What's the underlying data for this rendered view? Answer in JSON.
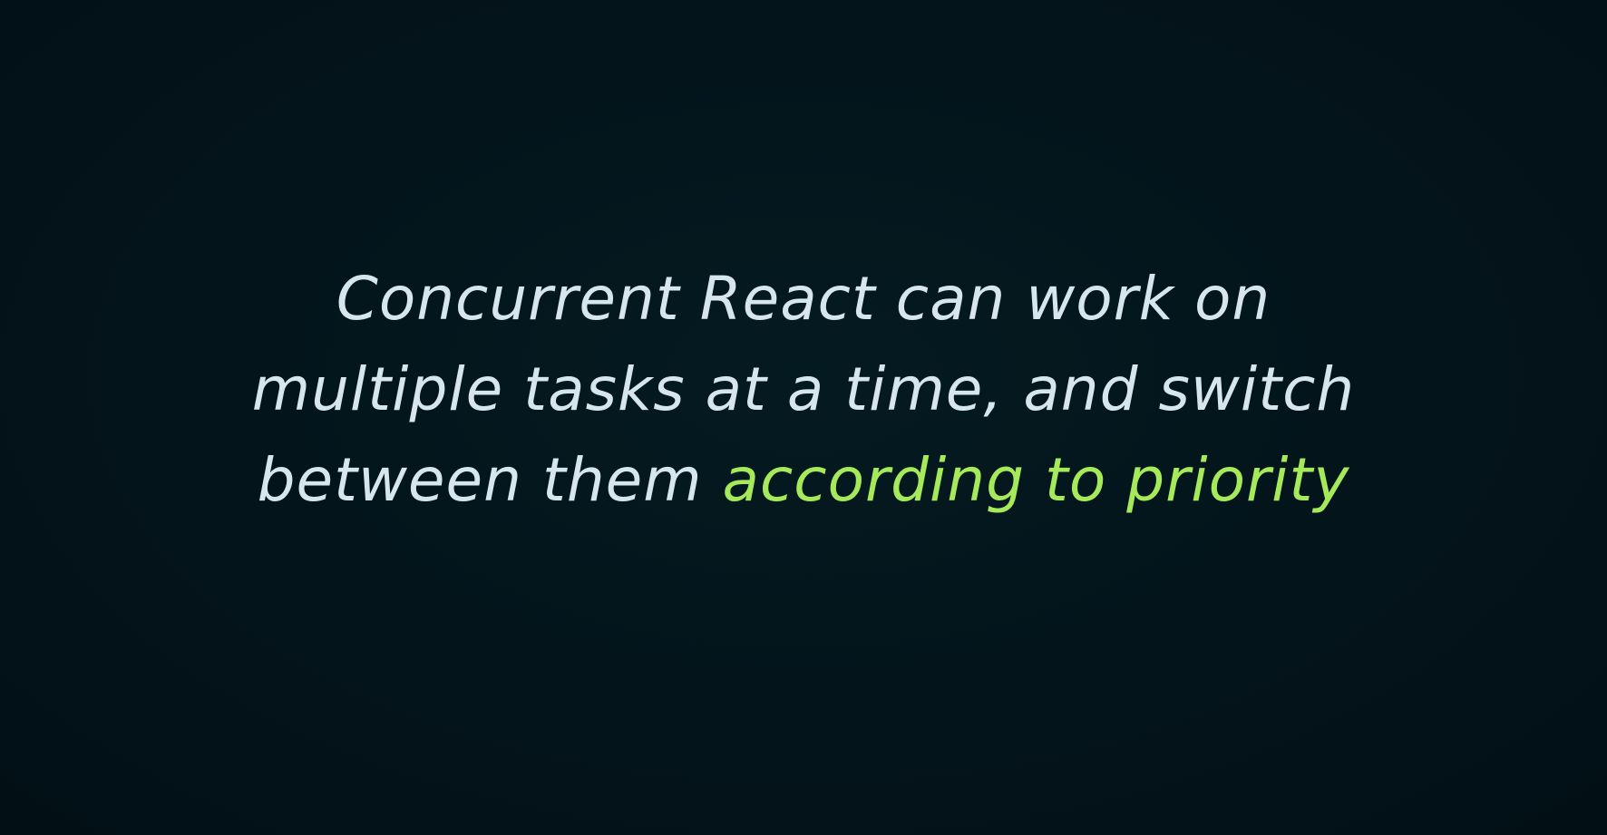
{
  "slide": {
    "lines": [
      {
        "text": "Concurrent React can work on"
      },
      {
        "text": "multiple tasks at a time, and switch"
      },
      {
        "text": "between them ",
        "highlight": "according to priority"
      }
    ],
    "colors": {
      "background": "#03141a",
      "text": "#d7e6ee",
      "highlight": "#a6ea5c"
    }
  }
}
